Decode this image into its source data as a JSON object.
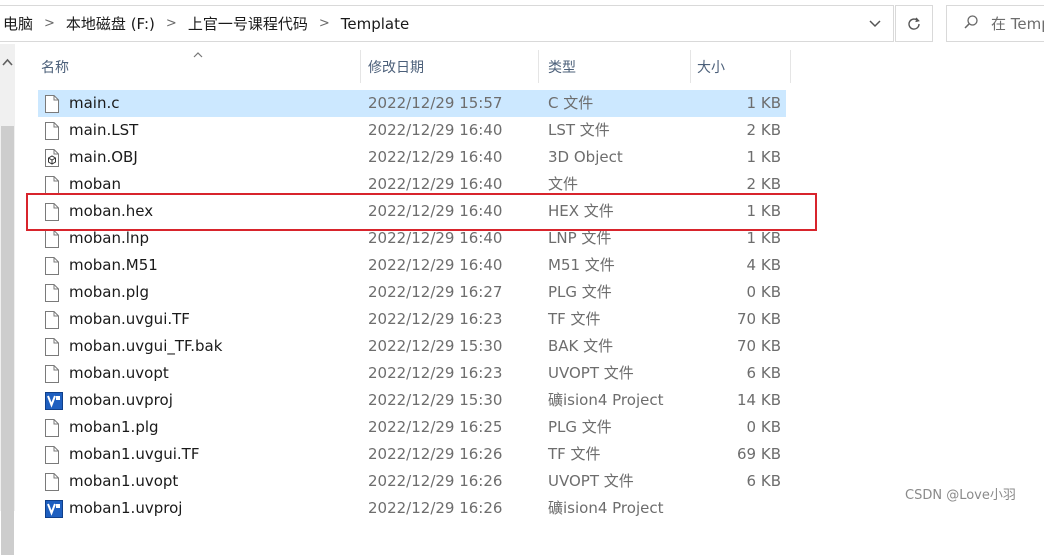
{
  "address": {
    "crumbs": [
      "电脑",
      "本地磁盘 (F:)",
      "上官一号课程代码",
      "Template"
    ]
  },
  "search": {
    "placeholder": "在 Temp"
  },
  "columns": {
    "name": "名称",
    "date": "修改日期",
    "type": "类型",
    "size": "大小"
  },
  "files": [
    {
      "name": "main.c",
      "date": "2022/12/29 15:57",
      "type": "C 文件",
      "size": "1 KB",
      "icon": "file-icon",
      "selected": true
    },
    {
      "name": "main.LST",
      "date": "2022/12/29 16:40",
      "type": "LST 文件",
      "size": "2 KB",
      "icon": "file-icon"
    },
    {
      "name": "main.OBJ",
      "date": "2022/12/29 16:40",
      "type": "3D Object",
      "size": "1 KB",
      "icon": "3d-object-icon"
    },
    {
      "name": "moban",
      "date": "2022/12/29 16:40",
      "type": "文件",
      "size": "2 KB",
      "icon": "file-icon"
    },
    {
      "name": "moban.hex",
      "date": "2022/12/29 16:40",
      "type": "HEX 文件",
      "size": "1 KB",
      "icon": "file-icon",
      "highlighted": true
    },
    {
      "name": "moban.lnp",
      "date": "2022/12/29 16:40",
      "type": "LNP 文件",
      "size": "1 KB",
      "icon": "file-icon"
    },
    {
      "name": "moban.M51",
      "date": "2022/12/29 16:40",
      "type": "M51 文件",
      "size": "4 KB",
      "icon": "file-icon"
    },
    {
      "name": "moban.plg",
      "date": "2022/12/29 16:27",
      "type": "PLG 文件",
      "size": "0 KB",
      "icon": "file-icon"
    },
    {
      "name": "moban.uvgui.TF",
      "date": "2022/12/29 16:23",
      "type": "TF 文件",
      "size": "70 KB",
      "icon": "file-icon"
    },
    {
      "name": "moban.uvgui_TF.bak",
      "date": "2022/12/29 15:30",
      "type": "BAK 文件",
      "size": "70 KB",
      "icon": "file-icon"
    },
    {
      "name": "moban.uvopt",
      "date": "2022/12/29 16:23",
      "type": "UVOPT 文件",
      "size": "6 KB",
      "icon": "file-icon"
    },
    {
      "name": "moban.uvproj",
      "date": "2022/12/29 15:30",
      "type": "礦ision4 Project",
      "size": "14 KB",
      "icon": "uvision-icon"
    },
    {
      "name": "moban1.plg",
      "date": "2022/12/29 16:25",
      "type": "PLG 文件",
      "size": "0 KB",
      "icon": "file-icon"
    },
    {
      "name": "moban1.uvgui.TF",
      "date": "2022/12/29 16:26",
      "type": "TF 文件",
      "size": "69 KB",
      "icon": "file-icon"
    },
    {
      "name": "moban1.uvopt",
      "date": "2022/12/29 16:26",
      "type": "UVOPT 文件",
      "size": "6 KB",
      "icon": "file-icon"
    },
    {
      "name": "moban1.uvproj",
      "date": "2022/12/29 16:26",
      "type": "礦ision4 Project",
      "size": "",
      "icon": "uvision-icon"
    }
  ],
  "watermark": "CSDN @Love小羽",
  "colors": {
    "selection": "#cce8ff",
    "highlight_border": "#d8242c",
    "header_text": "#4c607a"
  }
}
